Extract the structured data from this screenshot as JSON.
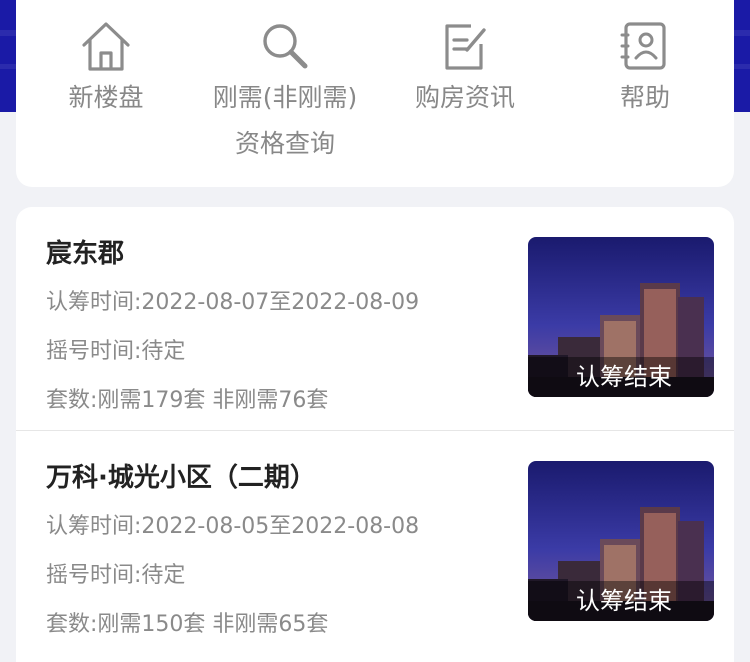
{
  "nav": {
    "items": [
      {
        "label": "新楼盘",
        "icon": "home-icon"
      },
      {
        "label": "刚需(非刚需)",
        "label2": "资格查询",
        "icon": "search-icon"
      },
      {
        "label": "购房资讯",
        "icon": "edit-document-icon"
      },
      {
        "label": "帮助",
        "icon": "help-contact-icon"
      }
    ]
  },
  "listings": [
    {
      "name": "宸东郡",
      "subscription": "认筹时间:2022-08-07至2022-08-09",
      "lottery": "摇号时间:待定",
      "units": "套数:刚需179套 非刚需76套",
      "status": "认筹结束"
    },
    {
      "name": "万科·城光小区（二期）",
      "subscription": "认筹时间:2022-08-05至2022-08-08",
      "lottery": "摇号时间:待定",
      "units": "套数:刚需150套 非刚需65套",
      "status": "认筹结束"
    }
  ],
  "colors": {
    "header_bg": "#1a1aa6",
    "page_bg": "#f1f2f6",
    "icon_gray": "#8c8c8c",
    "text_gray": "#8a8a8a"
  }
}
